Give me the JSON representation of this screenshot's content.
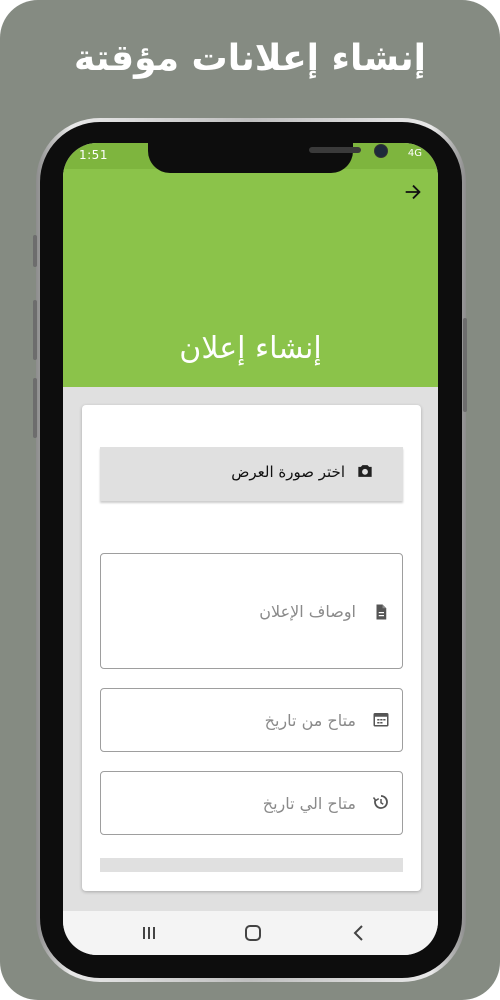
{
  "promo": {
    "headline": "إنشاء إعلانات مؤقتة"
  },
  "status_bar": {
    "time": "1:51",
    "right_text": "4G"
  },
  "app_bar": {
    "title": "إنشاء إعلان"
  },
  "form": {
    "image_button_label": "اختر صورة العرض",
    "description_placeholder": "اوصاف الإعلان",
    "from_date_placeholder": "متاح من تاريخ",
    "to_date_placeholder": "متاح الي تاريخ"
  },
  "icons": {
    "back": "arrow-right-icon",
    "image": "camera-icon",
    "description": "document-icon",
    "from_date": "calendar-icon",
    "to_date": "history-icon"
  },
  "colors": {
    "background": "#858b82",
    "app_bar": "#8bc34a",
    "status_bar": "#7eb53e",
    "screen_background": "#e0e0e0"
  }
}
